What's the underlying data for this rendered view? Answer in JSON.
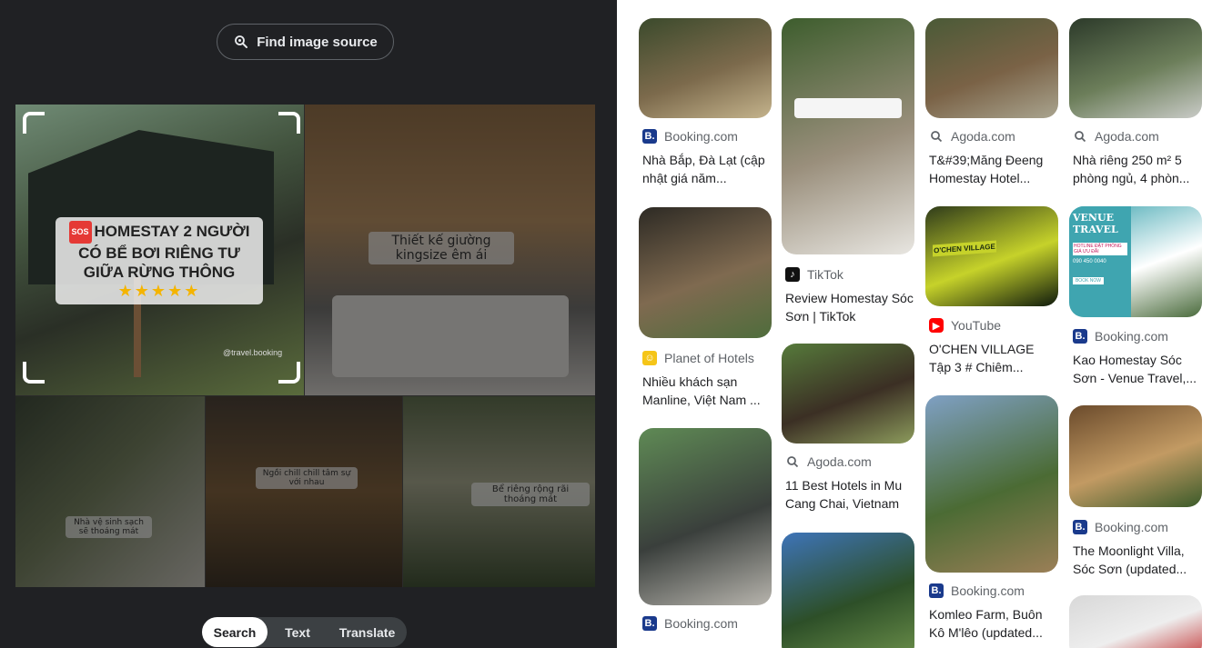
{
  "left_pane": {
    "find_source_label": "Find image source",
    "tabs": [
      {
        "label": "Search",
        "active": true
      },
      {
        "label": "Text",
        "active": false
      },
      {
        "label": "Translate",
        "active": false
      }
    ],
    "collage": {
      "banner_badge": "SOS",
      "banner_line1": "HOMESTAY 2 NGƯỜI",
      "banner_line2": "CÓ BỂ BƠI RIÊNG TƯ",
      "banner_line3": "GIỮA RỪNG THÔNG",
      "banner_stars": "★★★★★",
      "watermark": "@travel.booking",
      "caption_bedroom": "Thiết kế giường kingsize êm ái",
      "caption_bathroom": "Nhà vệ sinh sạch sẽ thoáng mát",
      "caption_lounge": "Ngồi chill chill tâm sự với nhau",
      "caption_outdoor": "Bể riêng rộng rãi thoáng mát"
    }
  },
  "results": {
    "col1": [
      {
        "source": "Booking.com",
        "favicon": "booking-favicon",
        "title": "Nhà Bắp, Đà Lạt (cập nhật giá năm...",
        "colors": [
          "#3b4a2c",
          "#7c6a4c",
          "#c4b38c"
        ]
      },
      {
        "source": "Planet of Hotels",
        "favicon": "planet-favicon",
        "title": "Nhiều khách sạn Manline, Việt Nam ...",
        "colors": [
          "#2d2a24",
          "#7f6a50",
          "#4f6d3c"
        ]
      },
      {
        "source": "Booking.com",
        "favicon": "booking-favicon",
        "title": "",
        "colors": [
          "#5f8a55",
          "#3a3f3c",
          "#b7b4ad"
        ]
      }
    ],
    "col2": [
      {
        "source": "TikTok",
        "favicon": "tiktok-favicon",
        "title": "Review Homestay Sóc Sơn | TikTok",
        "colors": [
          "#3d5d2d",
          "#9a8f7c",
          "#e8e6e1"
        ]
      },
      {
        "source": "Agoda.com",
        "favicon": "agoda-favicon",
        "title": "11 Best Hotels in Mu Cang Chai, Vietnam",
        "colors": [
          "#567a3b",
          "#3b2f24",
          "#8c9b5c"
        ]
      },
      {
        "source": "",
        "favicon": "",
        "title": "",
        "colors": [
          "#3e74b8",
          "#2d4f28",
          "#6b8f4a"
        ]
      }
    ],
    "col3": [
      {
        "source": "Agoda.com",
        "favicon": "agoda-favicon",
        "title": "T&#39;Măng Đeeng Homestay Hotel...",
        "colors": [
          "#4a5a37",
          "#7a6246",
          "#a9a48f"
        ]
      },
      {
        "source": "YouTube",
        "favicon": "youtube-favicon",
        "title": "O'CHEN VILLAGE Tập 3 # Chiêm...",
        "colors": [
          "#2f3b1b",
          "#c6d22a",
          "#0f1a0d"
        ]
      },
      {
        "source": "Booking.com",
        "favicon": "booking-favicon",
        "title": "Komleo Farm, Buôn Kô M'lêo (updated...",
        "colors": [
          "#7fa0c4",
          "#4b6b34",
          "#9b7f57"
        ]
      }
    ],
    "col4": [
      {
        "source": "Agoda.com",
        "favicon": "agoda-favicon",
        "title": "Nhà riêng 250 m² 5 phòng ngủ, 4 phòn...",
        "colors": [
          "#2c3a2a",
          "#6c7e5a",
          "#c9cbc7"
        ]
      },
      {
        "source": "Booking.com",
        "favicon": "booking-favicon",
        "title": "Kao Homestay Sóc Sơn - Venue Travel,...",
        "colors": [
          "#3fa5b0",
          "#ffffff",
          "#4a6b3c"
        ]
      },
      {
        "source": "Booking.com",
        "favicon": "booking-favicon",
        "title": "The Moonlight Villa, Sóc Sơn (updated...",
        "colors": [
          "#6b4b2c",
          "#c29a63",
          "#3b5b2a"
        ]
      },
      {
        "source": "",
        "favicon": "",
        "title": "",
        "colors": [
          "#d8d8d8",
          "#eeeeee",
          "#c43d3d"
        ]
      }
    ],
    "overlays": {
      "venue_title": "VENUE TRAVEL",
      "venue_sub": "HOTLINE ĐẶT PHÒNG GIÁ ƯU ĐÃI",
      "venue_phone": "090 450 0040",
      "venue_book": "BOOK NOW",
      "ochen_title": "O'CHEN VILLAGE"
    }
  }
}
